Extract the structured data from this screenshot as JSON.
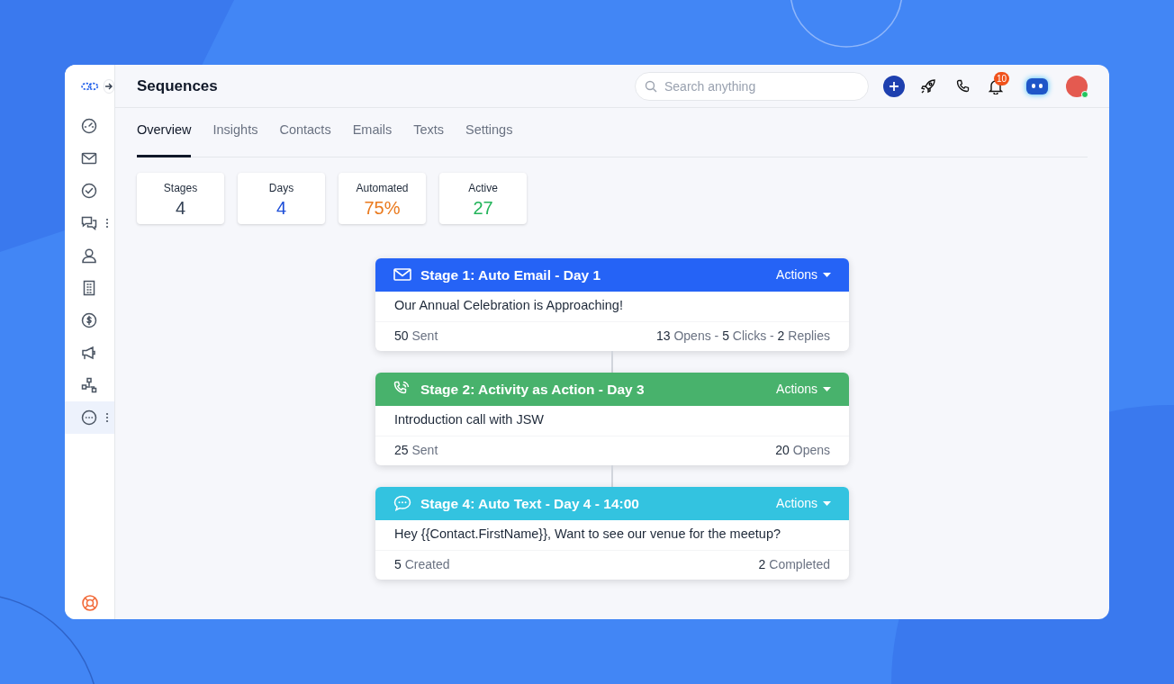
{
  "stat_separator": "-",
  "app": {
    "title": "Sequences",
    "search": {
      "placeholder": "Search anything"
    },
    "notifications": "10"
  },
  "sidebar": {
    "items": [
      {
        "kind": "dashboard",
        "selected": false,
        "menu": false
      },
      {
        "kind": "mail",
        "selected": false,
        "menu": false
      },
      {
        "kind": "tasks",
        "selected": false,
        "menu": false
      },
      {
        "kind": "chat",
        "selected": false,
        "menu": true
      },
      {
        "kind": "contact",
        "selected": false,
        "menu": false
      },
      {
        "kind": "company",
        "selected": false,
        "menu": false
      },
      {
        "kind": "deals",
        "selected": false,
        "menu": false
      },
      {
        "kind": "campaign",
        "selected": false,
        "menu": false
      },
      {
        "kind": "workflow",
        "selected": false,
        "menu": false
      },
      {
        "kind": "more",
        "selected": true,
        "menu": true
      }
    ]
  },
  "tabs": [
    {
      "label": "Overview",
      "selected": true
    },
    {
      "label": "Insights",
      "selected": false
    },
    {
      "label": "Contacts",
      "selected": false
    },
    {
      "label": "Emails",
      "selected": false
    },
    {
      "label": "Texts",
      "selected": false
    },
    {
      "label": "Settings",
      "selected": false
    }
  ],
  "stats": [
    {
      "label": "Stages",
      "value": "4",
      "color": "#334155"
    },
    {
      "label": "Days",
      "value": "4",
      "color": "#1d4ed8"
    },
    {
      "label": "Automated",
      "value": "75%",
      "color": "#ea7a1e"
    },
    {
      "label": "Active",
      "value": "27",
      "color": "#22b45a"
    }
  ],
  "stages": [
    {
      "kind": "email",
      "color": "#2563f6",
      "title": "Stage 1: Auto Email - Day 1",
      "actions": "Actions",
      "body": "Our Annual Celebration is Approaching!",
      "left": [
        {
          "count": "50",
          "label": "Sent"
        }
      ],
      "right": [
        {
          "count": "13",
          "label": "Opens"
        },
        {
          "count": "5",
          "label": "Clicks"
        },
        {
          "count": "2",
          "label": "Replies"
        }
      ]
    },
    {
      "kind": "call",
      "color": "#48b26c",
      "title": "Stage 2: Activity as Action - Day 3",
      "actions": "Actions",
      "body": "Introduction call with JSW",
      "left": [
        {
          "count": "25",
          "label": "Sent"
        }
      ],
      "right": [
        {
          "count": "20",
          "label": "Opens"
        }
      ]
    },
    {
      "kind": "text",
      "color": "#33c3e0",
      "title": "Stage 4: Auto Text - Day 4 - 14:00",
      "actions": "Actions",
      "body": "Hey {{Contact.FirstName}}, Want to see our venue for the meetup?",
      "left": [
        {
          "count": "5",
          "label": "Created"
        }
      ],
      "right": [
        {
          "count": "2",
          "label": "Completed"
        }
      ]
    }
  ]
}
